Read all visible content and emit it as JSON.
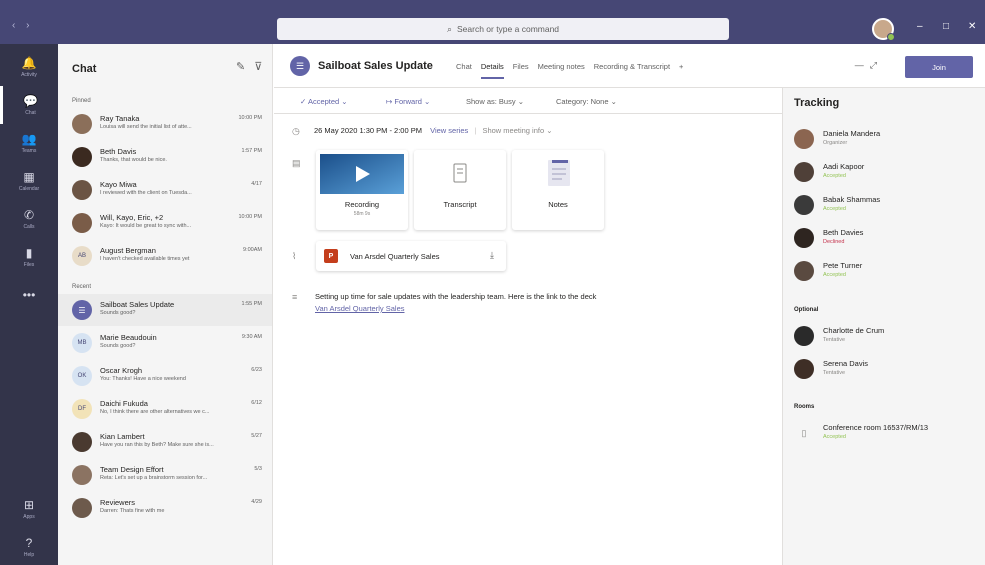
{
  "titlebar": {
    "nav": "‹ ›",
    "search_placeholder": "Search or type a command",
    "search_icon": "search-icon",
    "window_controls": [
      "–",
      "□",
      "✕"
    ]
  },
  "rail": [
    {
      "label": "Activity",
      "icon": "bell-icon",
      "glyph": "🔔"
    },
    {
      "label": "Chat",
      "icon": "chat-icon",
      "glyph": "💬",
      "active": true
    },
    {
      "label": "Teams",
      "icon": "teams-icon",
      "glyph": "👥"
    },
    {
      "label": "Calendar",
      "icon": "calendar-icon",
      "glyph": "▦"
    },
    {
      "label": "Calls",
      "icon": "phone-icon",
      "glyph": "✆"
    },
    {
      "label": "Files",
      "icon": "file-icon",
      "glyph": "▮"
    },
    {
      "label": "",
      "icon": "more-icon",
      "glyph": "•••"
    },
    {
      "label": "Apps",
      "icon": "apps-icon",
      "glyph": "⊞"
    },
    {
      "label": "Help",
      "icon": "help-icon",
      "glyph": "?"
    }
  ],
  "chat_list": {
    "title": "Chat",
    "pinned_label": "Pinned",
    "recent_label": "Recent",
    "pinned": [
      {
        "name": "Ray Tanaka",
        "preview": "Louisa will send the initial list of atte...",
        "time": "10:00 PM",
        "avatar_color": "#8b6f5a"
      },
      {
        "name": "Beth Davis",
        "preview": "Thanks, that would be nice.",
        "time": "1:57 PM",
        "avatar_color": "#3b2a20"
      },
      {
        "name": "Kayo Miwa",
        "preview": "I reviewed with the client on Tuesda...",
        "time": "4/17",
        "avatar_color": "#6b5444"
      },
      {
        "name": "Will, Kayo, Eric, +2",
        "preview": "Kayo: It would be great to sync with...",
        "time": "10:00 PM",
        "avatar_color": "#7a5c48"
      },
      {
        "name": "August Bergman",
        "preview": "I haven't checked available times yet",
        "time": "9:00AM",
        "avatar_color": "#e8dcc8",
        "initials": "AB"
      }
    ],
    "recent": [
      {
        "name": "Sailboat Sales Update",
        "preview": "Sounds good?",
        "time": "1:55 PM",
        "avatar_color": "#6264a7",
        "selected": true
      },
      {
        "name": "Marie Beaudouin",
        "preview": "Sounds good?",
        "time": "9:30 AM",
        "avatar_color": "#d6e3f2",
        "initials": "MB"
      },
      {
        "name": "Oscar Krogh",
        "preview": "You: Thanks! Have a nice weekend",
        "time": "6/23",
        "avatar_color": "#d6e3f2",
        "initials": "OK"
      },
      {
        "name": "Daichi Fukuda",
        "preview": "No, I think there are other alternatives we c...",
        "time": "6/12",
        "avatar_color": "#f2e3b8",
        "initials": "DF"
      },
      {
        "name": "Kian Lambert",
        "preview": "Have you ran this by Beth? Make sure she is...",
        "time": "5/27",
        "avatar_color": "#4a3a30"
      },
      {
        "name": "Team Design Effort",
        "preview": "Reta: Let's set up a brainstorm session for...",
        "time": "5/3",
        "avatar_color": "#8b7362"
      },
      {
        "name": "Reviewers",
        "preview": "Darren: Thats fine with me",
        "time": "4/29",
        "avatar_color": "#6d5a4c"
      }
    ]
  },
  "meeting": {
    "title": "Sailboat Sales Update",
    "tabs": [
      "Chat",
      "Details",
      "Files",
      "Meeting notes",
      "Recording & Transcript"
    ],
    "active_tab": "Details",
    "join_label": "Join",
    "toolbar": {
      "accepted": "✓ Accepted ⌄",
      "forward": "↦ Forward ⌄",
      "show_as": "Show as: Busy ⌄",
      "category": "Category: None ⌄"
    },
    "datetime": "26 May 2020 1:30 PM - 2:00 PM",
    "view_series": "View series",
    "show_meeting_info": "Show meeting info ⌄",
    "tiles": [
      {
        "label": "Recording",
        "sub": "58m 9s",
        "icon": "play-icon"
      },
      {
        "label": "Transcript",
        "sub": "",
        "icon": "transcript-icon"
      },
      {
        "label": "Notes",
        "sub": "",
        "icon": "notes-icon"
      }
    ],
    "attachment": {
      "name": "Van Arsdel Quarterly Sales",
      "icon_letter": "P"
    },
    "description": "Setting up time for sale updates with the leadership team. Here is the link to the deck",
    "description_link": "Van Arsdel Quarterly Sales"
  },
  "tracking": {
    "title": "Tracking",
    "optional_label": "Optional",
    "rooms_label": "Rooms",
    "required": [
      {
        "name": "Daniela Mandera",
        "status": "Organizer",
        "status_color": "#8a8886",
        "avatar_color": "#8b6550"
      },
      {
        "name": "Aadi Kapoor",
        "status": "Accepted",
        "status_color": "#92c353",
        "avatar_color": "#4f4038"
      },
      {
        "name": "Babak Shammas",
        "status": "Accepted",
        "status_color": "#92c353",
        "avatar_color": "#3a3a3a"
      },
      {
        "name": "Beth Davies",
        "status": "Declined",
        "status_color": "#c4314b",
        "avatar_color": "#2e2520"
      },
      {
        "name": "Pete Turner",
        "status": "Accepted",
        "status_color": "#92c353",
        "avatar_color": "#5a4a40"
      }
    ],
    "optional": [
      {
        "name": "Charlotte de Crum",
        "status": "Tentative",
        "status_color": "#8a8886",
        "avatar_color": "#2a2a2a"
      },
      {
        "name": "Serena Davis",
        "status": "Tentative",
        "status_color": "#8a8886",
        "avatar_color": "#3e2e26"
      }
    ],
    "rooms": [
      {
        "name": "Conference room 16537/RM/13",
        "status": "Accepted",
        "status_color": "#92c353"
      }
    ]
  }
}
